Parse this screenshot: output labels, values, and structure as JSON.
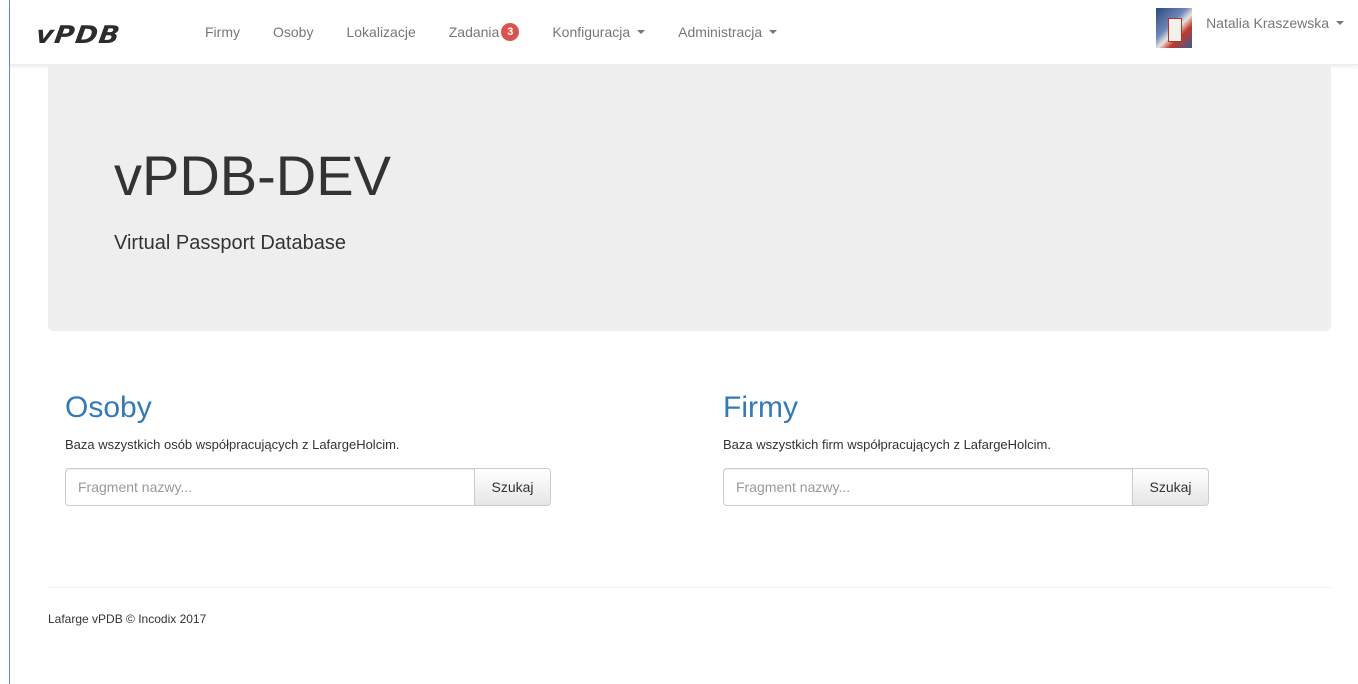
{
  "navbar": {
    "brand": "vPDB",
    "links": [
      {
        "label": "Firmy"
      },
      {
        "label": "Osoby"
      },
      {
        "label": "Lokalizacje"
      },
      {
        "label": "Zadania",
        "badge": "3"
      },
      {
        "label": "Konfiguracja"
      },
      {
        "label": "Administracja"
      }
    ],
    "user": {
      "name": "Natalia Kraszewska"
    }
  },
  "jumbotron": {
    "title": "vPDB-DEV",
    "subtitle": "Virtual Passport Database"
  },
  "sections": {
    "osoby": {
      "title": "Osoby",
      "description": "Baza wszystkich osób współpracujących z LafargeHolcim.",
      "placeholder": "Fragment nazwy...",
      "button": "Szukaj"
    },
    "firmy": {
      "title": "Firmy",
      "description": "Baza wszystkich firm współpracujących z LafargeHolcim.",
      "placeholder": "Fragment nazwy...",
      "button": "Szukaj"
    }
  },
  "footer": {
    "text": "Lafarge vPDB © Incodix 2017"
  },
  "colors": {
    "link_blue": "#337ab7",
    "badge_red": "#d9534f",
    "jumbotron_bg": "#eeeeee"
  }
}
